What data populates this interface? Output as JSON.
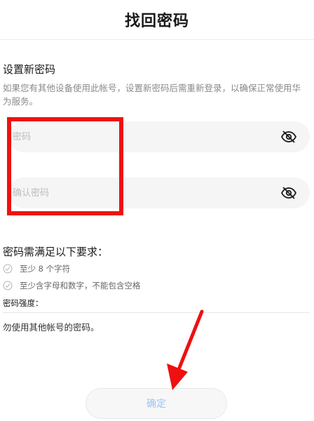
{
  "header": {
    "title": "找回密码"
  },
  "section": {
    "title": "设置新密码",
    "description": "如果您有其他设备使用此帐号，设置新密码后需重新登录，以确保正常使用华为服务。"
  },
  "form": {
    "password_placeholder": "密码",
    "confirm_placeholder": "确认密码",
    "password_value": "",
    "confirm_value": ""
  },
  "requirements": {
    "title": "密码需满足以下要求：",
    "items": [
      {
        "label": "至少 8 个字符"
      },
      {
        "label": "至少含字母和数字，不能包含空格"
      }
    ],
    "strength_label": "密码强度：",
    "tip": "勿使用其他帐号的密码。"
  },
  "submit": {
    "label": "确定"
  },
  "icons": {
    "password_toggle": "eye-off-icon",
    "confirm_toggle": "eye-off-icon",
    "requirement_check": "check-circle-icon"
  },
  "colors": {
    "highlight": "#ee1111",
    "button_text": "#9dc3f0",
    "input_bg": "#f5f5f5",
    "muted_text": "#8a8a8a"
  }
}
